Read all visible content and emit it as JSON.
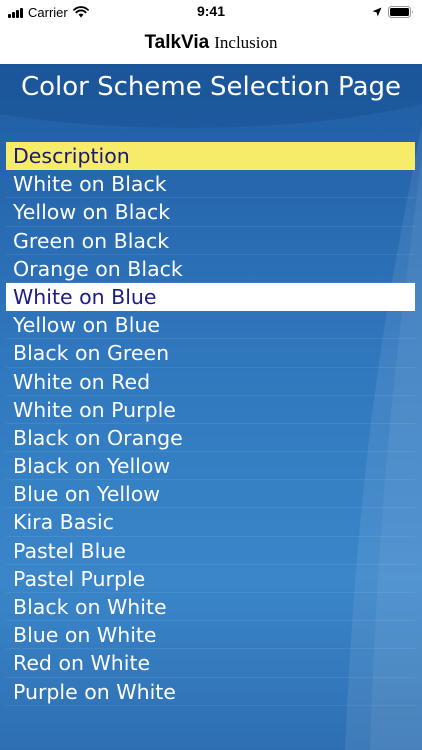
{
  "status_bar": {
    "carrier": "Carrier",
    "time": "9:41",
    "icons": [
      "signal-icon",
      "wifi-icon",
      "location-arrow-icon",
      "battery-icon"
    ]
  },
  "nav": {
    "brand_main": "TalkVia",
    "brand_sub": "Inclusion"
  },
  "page": {
    "title": "Color Scheme Selection Page"
  },
  "list": {
    "header": "Description",
    "items": [
      "White on Black",
      "Yellow on Black",
      "Green on Black",
      "Orange on Black",
      "White on Blue",
      "Yellow on Blue",
      "Black on Green",
      "White on Red",
      "White on Purple",
      "Black on Orange",
      "Black on Yellow",
      "Blue on Yellow",
      "Kira Basic",
      "Pastel Blue",
      "Pastel Purple",
      "Black on White",
      "Blue on White",
      "Red on White",
      "Purple on White"
    ],
    "selected_item": "White on Blue"
  },
  "colors": {
    "background_blue": "#2f76bd",
    "header_highlight": "#f7ec6a",
    "selected_row": "#ffffff",
    "selected_text": "#1c1c85",
    "item_text": "#ffffff"
  }
}
